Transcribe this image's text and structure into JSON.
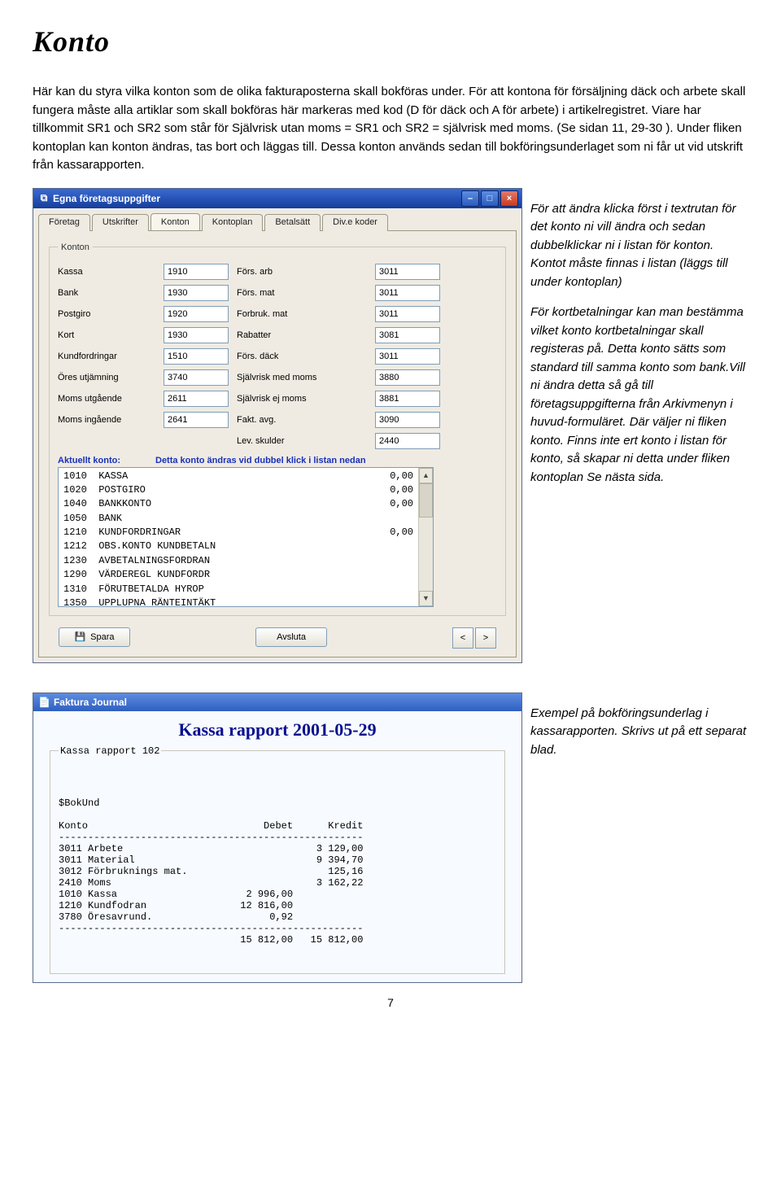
{
  "page": {
    "title": "Konto",
    "intro": "Här kan du styra vilka konton som de olika fakturaposterna skall bokföras under.\nFör att kontona för försäljning däck och arbete skall fungera måste alla artiklar som skall bokföras här markeras med kod (D för däck och A för arbete) i artikelregistret. Viare har tillkommit SR1 och SR2 som står för Självrisk utan moms = SR1 och SR2 = självrisk med moms. (Se sidan 11, 29-30 ). Under fliken kontoplan kan konton ändras, tas bort och läggas till. Dessa konton används sedan till bokföringsunderlaget som ni får ut vid utskrift från kassarapporten.",
    "page_number": "7"
  },
  "side1": {
    "p1": "För att ändra klicka först i textrutan för det konto ni vill ändra och sedan dubbelklickar ni i listan för konton. Kontot måste finnas i listan (läggs till under kontoplan)",
    "p2": "För kortbetalningar kan man bestämma vilket konto kortbetalningar skall registeras på. Detta konto sätts som standard till samma konto som bank.Vill ni ändra detta så gå till företagsuppgifterna från Arkivmenyn i huvud-formuläret. Där väljer ni fliken konto. Finns inte ert konto i listan för konto, så skapar ni detta under fliken kontoplan Se nästa sida."
  },
  "side2": {
    "p1": "Exempel på bokföringsunderlag i kassarapporten. Skrivs ut på ett separat blad."
  },
  "win1": {
    "title": "Egna företagsuppgifter",
    "tabs": [
      "Företag",
      "Utskrifter",
      "Konton",
      "Kontoplan",
      "Betalsätt",
      "Div.e koder"
    ],
    "active_tab": 2,
    "group_label": "Konton",
    "fields": [
      {
        "l": "Kassa",
        "v": "1910",
        "rl": "Förs. arb",
        "rv": "3011"
      },
      {
        "l": "Bank",
        "v": "1930",
        "rl": "Förs. mat",
        "rv": "3011"
      },
      {
        "l": "Postgiro",
        "v": "1920",
        "rl": "Forbruk. mat",
        "rv": "3011"
      },
      {
        "l": "Kort",
        "v": "1930",
        "rl": "Rabatter",
        "rv": "3081"
      },
      {
        "l": "Kundfordringar",
        "v": "1510",
        "rl": "Förs. däck",
        "rv": "3011"
      },
      {
        "l": "Öres utjämning",
        "v": "3740",
        "rl": "Självrisk med moms",
        "rv": "3880"
      },
      {
        "l": "Moms utgående",
        "v": "2611",
        "rl": "Självrisk ej moms",
        "rv": "3881"
      },
      {
        "l": "Moms ingående",
        "v": "2641",
        "rl": "Fakt. avg.",
        "rv": "3090"
      },
      {
        "l": "",
        "v": "",
        "rl": "Lev. skulder",
        "rv": "2440"
      }
    ],
    "aktuellt_label": "Aktuellt konto:",
    "aktuellt_note": "Detta konto ändras vid dubbel klick i listan nedan",
    "list": [
      {
        "n": "1010",
        "t": "KASSA",
        "a": "0,00"
      },
      {
        "n": "1020",
        "t": "POSTGIRO",
        "a": "0,00"
      },
      {
        "n": "1040",
        "t": "BANKKONTO",
        "a": "0,00"
      },
      {
        "n": "1050",
        "t": "BANK",
        "a": ""
      },
      {
        "n": "1210",
        "t": "KUNDFORDRINGAR",
        "a": "0,00"
      },
      {
        "n": "1212",
        "t": "OBS.KONTO KUNDBETALN",
        "a": ""
      },
      {
        "n": "1230",
        "t": "AVBETALNINGSFORDRAN",
        "a": ""
      },
      {
        "n": "1290",
        "t": "VÄRDEREGL KUNDFORDR",
        "a": ""
      },
      {
        "n": "1310",
        "t": "FÖRUTBETALDA HYROP",
        "a": ""
      },
      {
        "n": "1350",
        "t": "UPPLUPNA RÄNTEINTÄKT",
        "a": ""
      }
    ],
    "btn_save": "Spara",
    "btn_close": "Avsluta"
  },
  "win2": {
    "title": "Faktura Journal",
    "report_title": "Kassa rapport 2001-05-29",
    "group_label": "Kassa rapport 102",
    "var_line": "$BokUnd",
    "header": {
      "konto": "Konto",
      "debet": "Debet",
      "kredit": "Kredit"
    },
    "rows": [
      {
        "k": "3011 Arbete",
        "d": "",
        "c": "3 129,00"
      },
      {
        "k": "3011 Material",
        "d": "",
        "c": "9 394,70"
      },
      {
        "k": "3012 Förbruknings mat.",
        "d": "",
        "c": "125,16"
      },
      {
        "k": "2410 Moms",
        "d": "",
        "c": "3 162,22"
      },
      {
        "k": "1010 Kassa",
        "d": "2 996,00",
        "c": ""
      },
      {
        "k": "1210 Kundfodran",
        "d": "12 816,00",
        "c": ""
      },
      {
        "k": "3780 Öresavrund.",
        "d": "0,92",
        "c": ""
      }
    ],
    "totals": {
      "d": "15 812,00",
      "c": "15 812,00"
    }
  }
}
